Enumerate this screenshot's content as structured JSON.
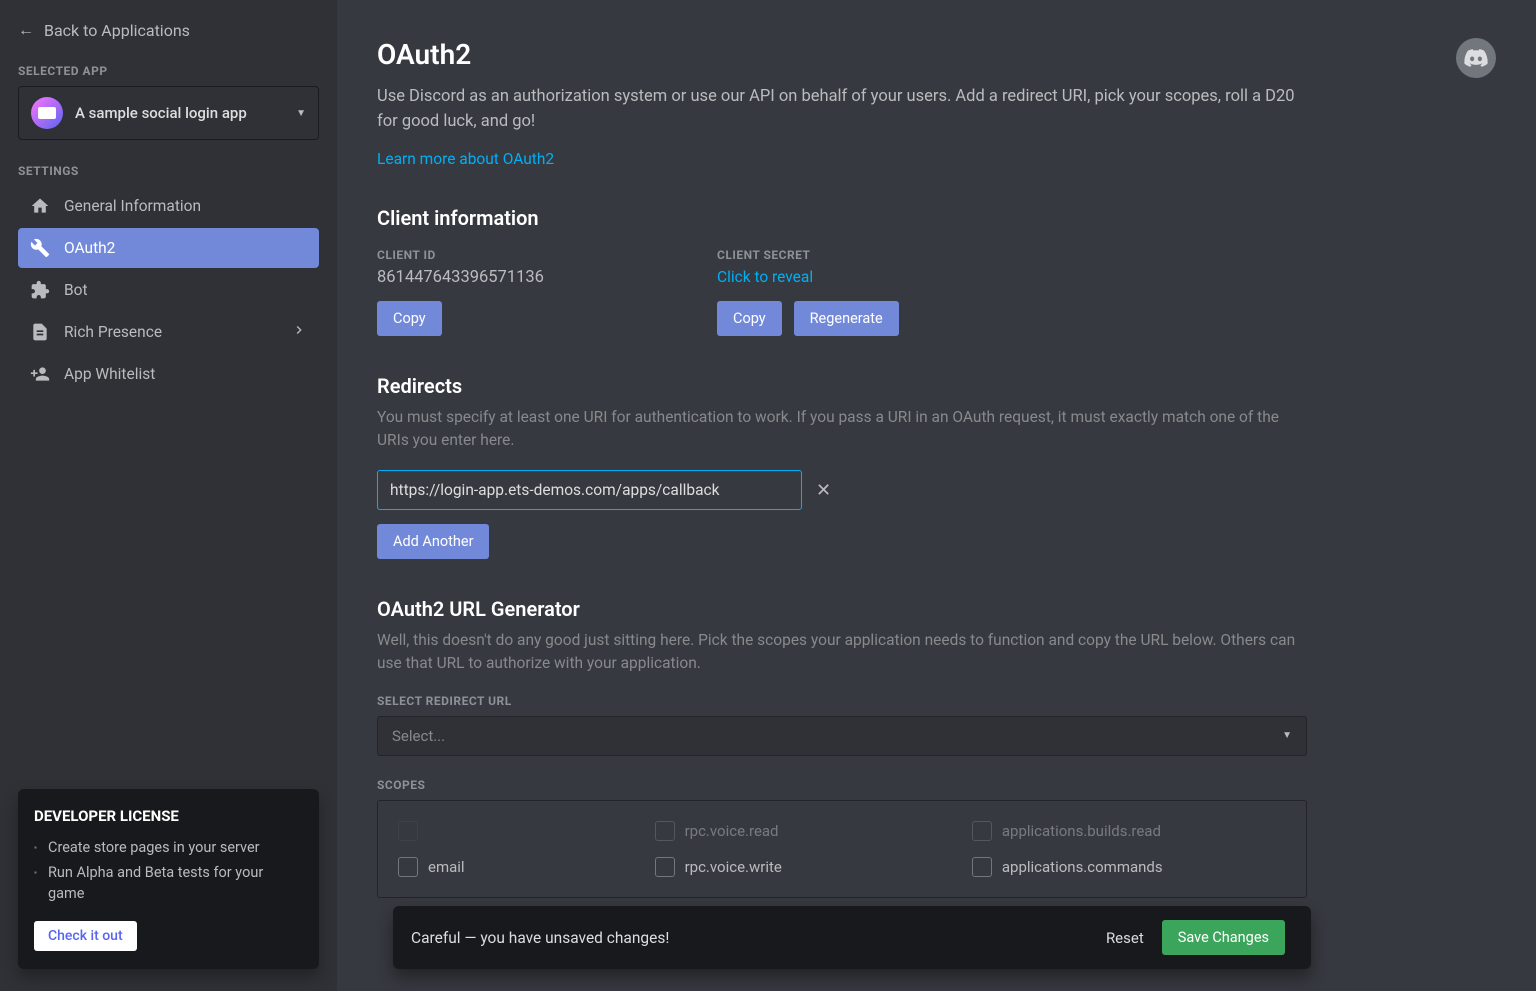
{
  "sidebar": {
    "back": "Back to Applications",
    "selected_app_label": "SELECTED APP",
    "app_name": "A sample social login app",
    "settings_label": "SETTINGS",
    "items": [
      {
        "label": "General Information"
      },
      {
        "label": "OAuth2"
      },
      {
        "label": "Bot"
      },
      {
        "label": "Rich Presence"
      },
      {
        "label": "App Whitelist"
      }
    ]
  },
  "license": {
    "title": "DEVELOPER LICENSE",
    "item1": "Create store pages in your server",
    "item2": "Run Alpha and Beta tests for your game",
    "cta": "Check it out"
  },
  "page": {
    "title": "OAuth2",
    "subtitle": "Use Discord as an authorization system or use our API on behalf of your users. Add a redirect URI, pick your scopes, roll a D20 for good luck, and go!",
    "learn_more": "Learn more about OAuth2"
  },
  "client": {
    "heading": "Client information",
    "id_label": "CLIENT ID",
    "id_value": "861447643396571136",
    "secret_label": "CLIENT SECRET",
    "reveal": "Click to reveal",
    "copy": "Copy",
    "regenerate": "Regenerate"
  },
  "redirects": {
    "heading": "Redirects",
    "desc": "You must specify at least one URI for authentication to work. If you pass a URI in an OAuth request, it must exactly match one of the URIs you enter here.",
    "value": "https://login-app.ets-demos.com/apps/callback",
    "add": "Add Another"
  },
  "generator": {
    "heading": "OAuth2 URL Generator",
    "desc": "Well, this doesn't do any good just sitting here. Pick the scopes your application needs to function and copy the URL below. Others can use that URL to authorize with your application.",
    "select_label": "SELECT REDIRECT URL",
    "select_placeholder": "Select...",
    "scopes_label": "SCOPES",
    "scopes_col1": [
      "email"
    ],
    "scopes_col2": [
      "rpc.voice.read",
      "rpc.voice.write"
    ],
    "scopes_col3": [
      "applications.builds.read",
      "applications.commands"
    ]
  },
  "unsaved": {
    "message": "Careful — you have unsaved changes!",
    "reset": "Reset",
    "save": "Save Changes"
  }
}
